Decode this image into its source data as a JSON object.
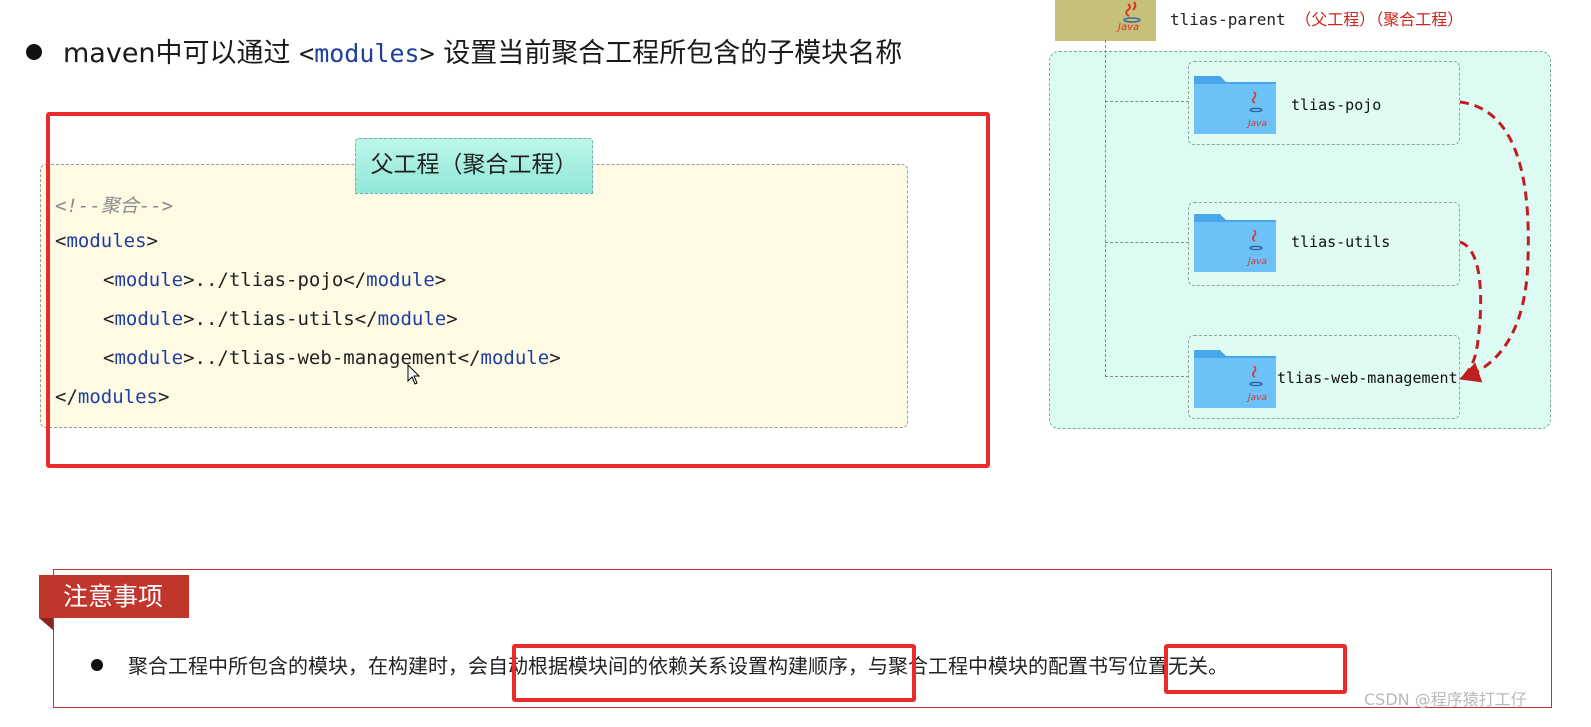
{
  "headline": {
    "prefix": "maven中可以通过 ",
    "code_open": "<",
    "code_kw": "modules",
    "code_close": ">",
    "suffix": " 设置当前聚合工程所包含的子模块名称"
  },
  "code_panel": {
    "tab_title": "父工程（聚合工程）",
    "comment": "<!--聚合-->",
    "open_lt": "<",
    "open_name": "modules",
    "open_gt": ">",
    "modules": [
      {
        "path": "../tlias-pojo"
      },
      {
        "path": "../tlias-utils"
      },
      {
        "path": "../tlias-web-management"
      }
    ],
    "tag_module": "module",
    "close_lt": "</",
    "close_name": "modules",
    "close_gt": ">"
  },
  "diagram": {
    "parent_name": "tlias-parent",
    "parent_tags": "（父工程）（聚合工程）",
    "java_label": "Java",
    "modules": [
      "tlias-pojo",
      "tlias-utils",
      "tlias-web-management"
    ],
    "colors": {
      "arrow": "#c01f1f",
      "folder": "#5cb8f5",
      "panel": "#dcfbf3"
    }
  },
  "notes": {
    "title": "注意事项",
    "text_part1": "聚合工程中所包含的模块，在构建时，会",
    "text_highlight1": "自动根据模块间的依赖关系设置构建顺序",
    "text_part2": "，与聚合工程中模块的配置",
    "text_highlight2": "书写位置无关。"
  },
  "watermark": "CSDN @程序猿打工仔"
}
